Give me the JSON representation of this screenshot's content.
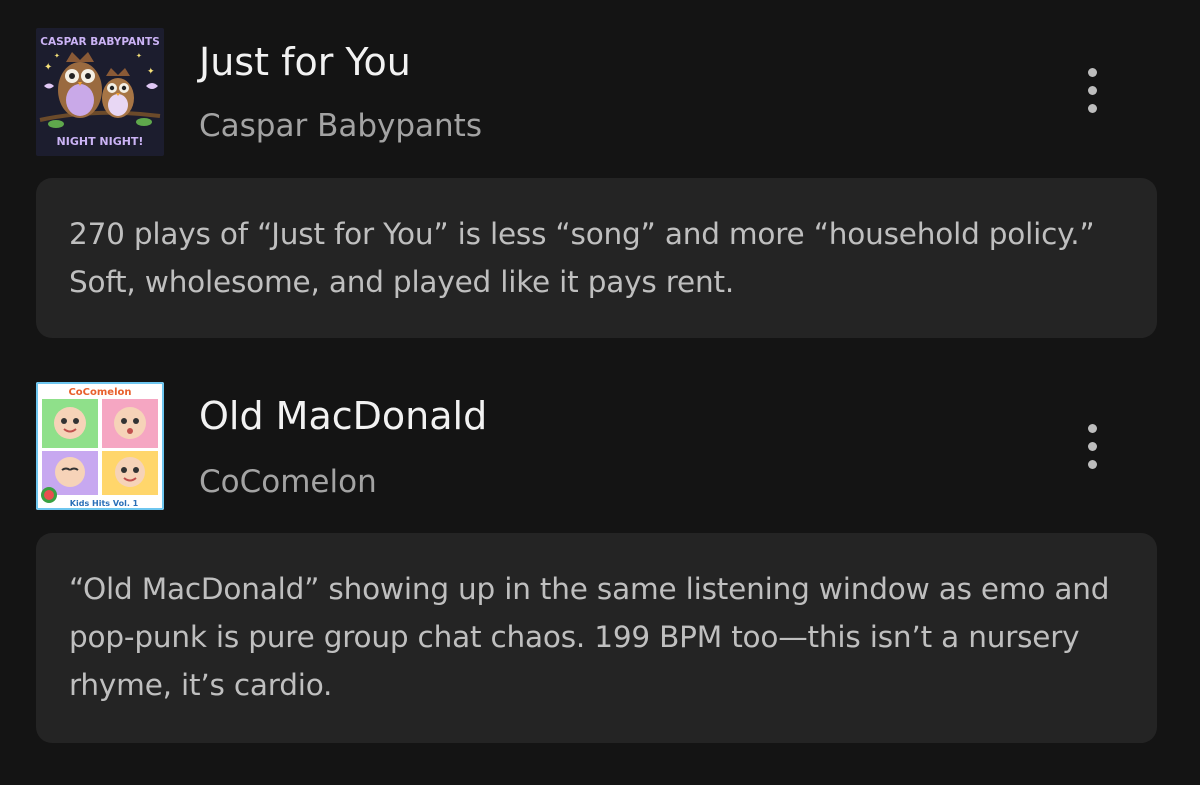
{
  "tracks": [
    {
      "title": "Just for You",
      "artist": "Caspar Babypants",
      "cover": {
        "top_text": "CASPAR BABYPANTS",
        "bottom_text": "NIGHT NIGHT!",
        "bg": "#1c1d2e",
        "accent": "#cbb3f5",
        "label_bg": "#e3d4f7"
      },
      "comment": "270 plays of “Just for You” is less “song” and more “household policy.” Soft, wholesome, and played like it pays rent."
    },
    {
      "title": "Old MacDonald",
      "artist": "CoComelon",
      "cover": {
        "top_text": "CoComelon",
        "bottom_text": "Kids Hits Vol. 1",
        "tile_colors": [
          "#8fe08a",
          "#f5a6c2",
          "#c7a8f0",
          "#ffd66b"
        ],
        "border": "#6ec6ef"
      },
      "comment": "“Old MacDonald” showing up in the same listening window as emo and pop-punk is pure group chat chaos. 199 BPM too—this isn’t a nursery rhyme, it’s cardio."
    }
  ],
  "icons": {
    "more": "more-vertical-icon"
  },
  "colors": {
    "background": "#141414",
    "card": "#242424",
    "title": "#f2f2f2",
    "subtitle": "#a3a3a3",
    "comment": "#bfbfbf"
  }
}
